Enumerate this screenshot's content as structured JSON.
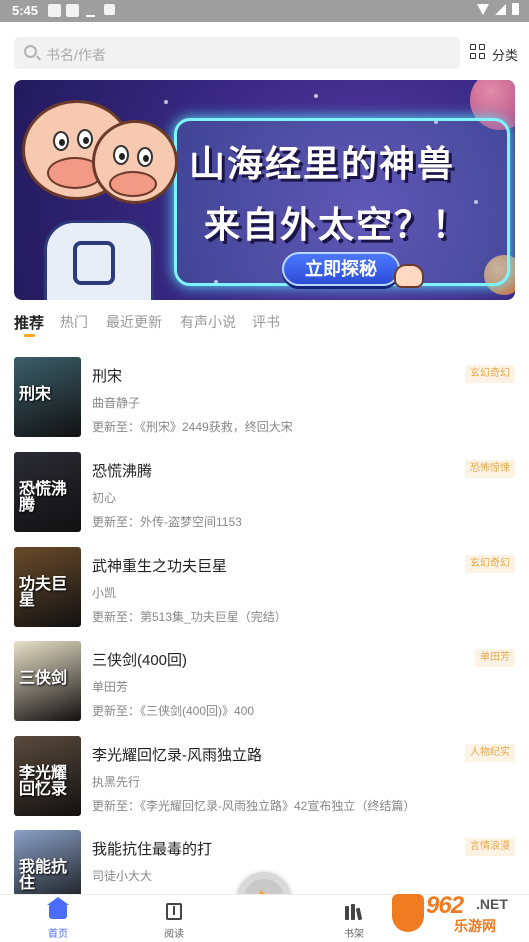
{
  "status_bar": {
    "time": "5:45"
  },
  "search": {
    "placeholder": "书名/作者"
  },
  "category": {
    "label": "分类"
  },
  "banner": {
    "line1": "山海经里的神兽",
    "line2": "来自外太空？！",
    "cta": "立即探秘"
  },
  "tabs": [
    {
      "label": "推荐",
      "active": true
    },
    {
      "label": "热门"
    },
    {
      "label": "最近更新"
    },
    {
      "label": "有声小说"
    },
    {
      "label": "评书"
    }
  ],
  "books": [
    {
      "title": "刑宋",
      "author": "曲音静子",
      "update": "更新至：《刑宋》2449获救，终回大宋",
      "tag": "玄幻奇幻",
      "cover_text": "刑宋",
      "cover_color": "#3c5f6a"
    },
    {
      "title": "恐慌沸腾",
      "author": "初心",
      "update": "更新至：外传-盗梦空间1153",
      "tag": "恐怖惊悚",
      "cover_text": "恐慌沸腾",
      "cover_color": "#2b2b33"
    },
    {
      "title": "武神重生之功夫巨星",
      "author": "小凯",
      "update": "更新至：第513集_功夫巨星（完结）",
      "tag": "玄幻奇幻",
      "cover_text": "功夫巨星",
      "cover_color": "#6a4b2a"
    },
    {
      "title": "三侠剑(400回)",
      "author": "单田芳",
      "update": "更新至：《三侠剑(400回)》400",
      "tag": "单田芳",
      "cover_text": "三侠剑",
      "cover_color": "#e9e0c8"
    },
    {
      "title": "李光耀回忆录-风雨独立路",
      "author": "执黑先行",
      "update": "更新至：《李光耀回忆录-风雨独立路》42宣布独立（终结篇）",
      "tag": "人物纪实",
      "cover_text": "李光耀回忆录",
      "cover_color": "#5a4a3c"
    },
    {
      "title": "我能抗住最毒的打",
      "author": "司徒小大大",
      "update": "",
      "tag": "言情浪漫",
      "cover_text": "我能抗住",
      "cover_color": "#8aa0c8"
    }
  ],
  "bottom_nav": [
    {
      "label": "首页",
      "icon": "home-icon",
      "active": true
    },
    {
      "label": "阅读",
      "icon": "book-icon"
    },
    {
      "label": "书架",
      "icon": "bookshelf-icon"
    }
  ],
  "watermark": {
    "num": "962",
    "net": ".NET",
    "cn": "乐游网"
  },
  "colors": {
    "accent": "#f5a623",
    "nav_active": "#4a6cf7",
    "tag_bg": "#fdf3e4",
    "tag_text": "#e8a94b"
  }
}
